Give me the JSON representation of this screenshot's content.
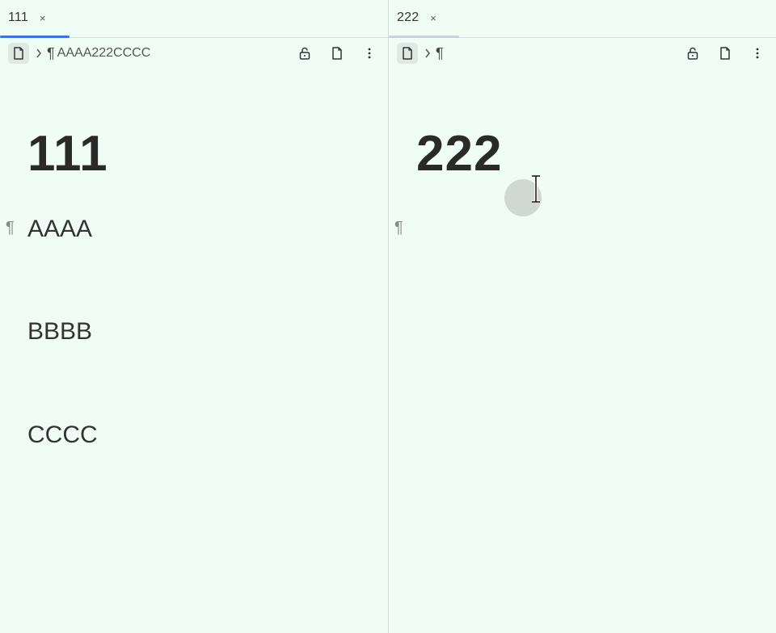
{
  "left_pane": {
    "tab": {
      "title": "111",
      "close": "×"
    },
    "breadcrumb": {
      "chevron": ">",
      "pilcrow": "¶",
      "text": "AAAA222CCCC"
    },
    "heading": "111",
    "paragraph_mark": "¶",
    "paragraphs": [
      "AAAA",
      "BBBB",
      "CCCC"
    ]
  },
  "right_pane": {
    "tab": {
      "title": "222",
      "close": "×"
    },
    "breadcrumb": {
      "chevron": ">",
      "pilcrow": "¶",
      "text": ""
    },
    "heading": "222",
    "paragraph_mark": "¶"
  },
  "icons": {
    "document": "document-icon",
    "lock_open": "lock-open-icon",
    "more": "more-vertical-icon",
    "chevron": "chevron-right-icon",
    "text_cursor": "text-cursor-icon"
  },
  "colors": {
    "background": "#effdf4",
    "active_tab_indicator": "#3b6fe8",
    "inactive_tab_indicator": "#c9d2dc"
  }
}
